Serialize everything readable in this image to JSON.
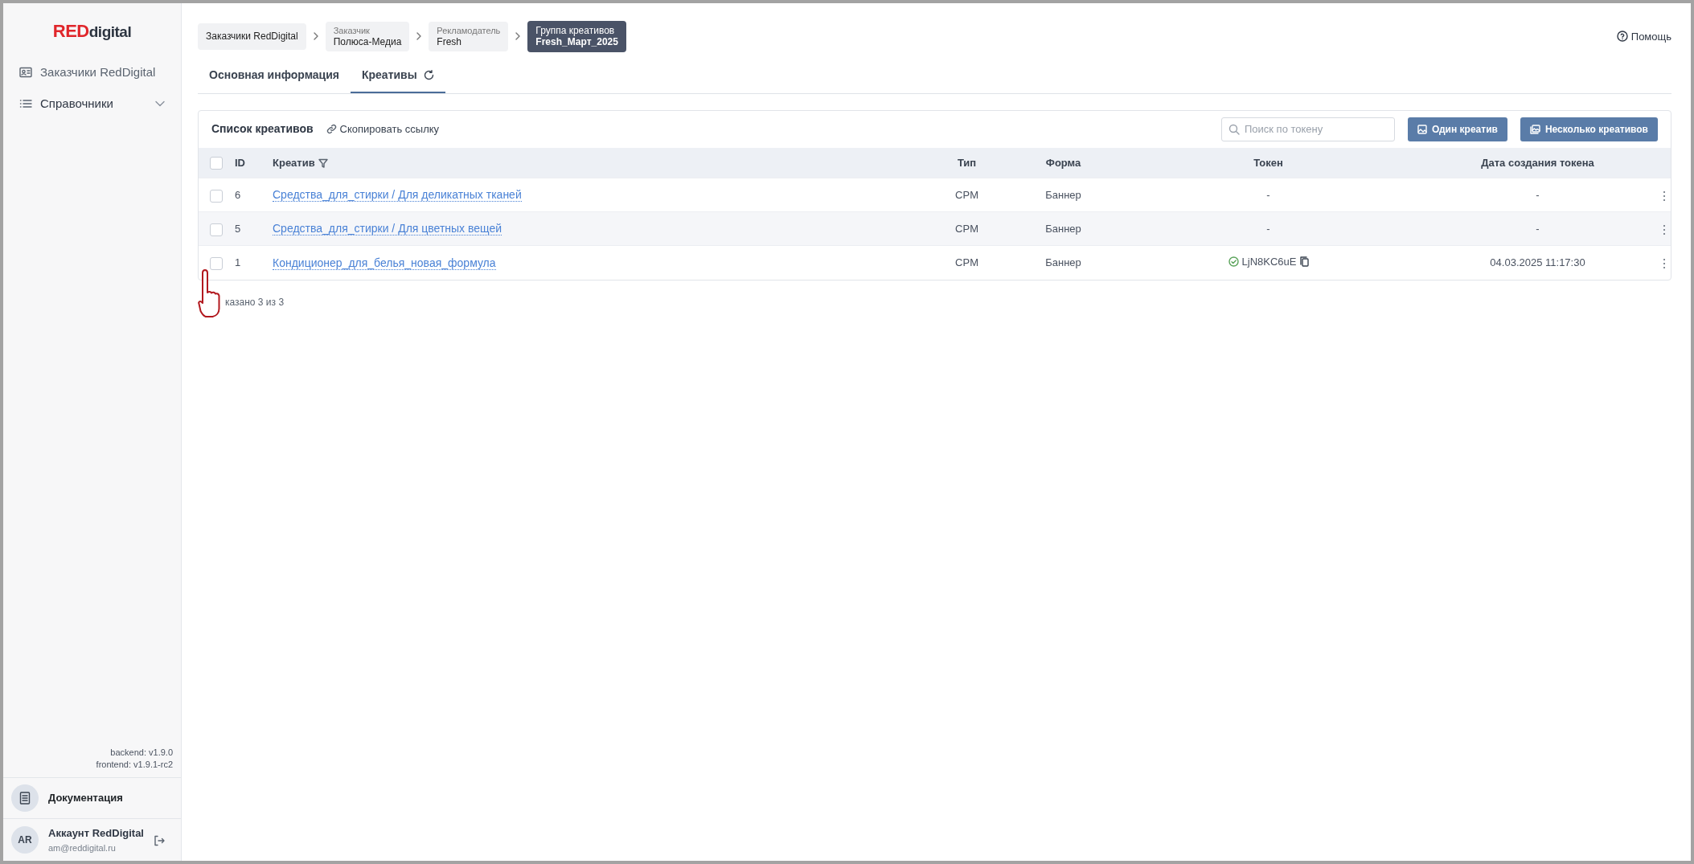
{
  "sidebar": {
    "logo": {
      "strong": "RED",
      "light": "digital"
    },
    "items": [
      {
        "kind": "link",
        "label": "Заказчики RedDigital"
      },
      {
        "kind": "group",
        "label": "Справочники",
        "expanded": false
      }
    ],
    "versions": [
      "backend: v1.9.0",
      "frontend: v1.9.1-rc2"
    ],
    "docs": "Документация",
    "account": {
      "initials": "AR",
      "name": "Аккаунт RedDigital",
      "email": "am@reddigital.ru"
    }
  },
  "breadcrumbs": [
    {
      "label": "Заказчики RedDigital",
      "current": false
    },
    {
      "caption": "Заказчик",
      "label": "Полюса-Медиа",
      "current": false
    },
    {
      "caption": "Рекламодатель",
      "label": "Fresh",
      "current": false
    },
    {
      "caption": "Группа креативов",
      "label": "Fresh_Март_2025",
      "current": true
    }
  ],
  "help": "Помощь",
  "tabs": [
    {
      "label": "Основная информация",
      "selected": false
    },
    {
      "label": "Креативы",
      "selected": true
    }
  ],
  "card": {
    "title": "Список креативов",
    "copy_link": "Скопировать ссылку",
    "search": {
      "placeholder": "Поиск по токену"
    },
    "buttons": [
      "Один креатив",
      "Несколько креативов"
    ]
  },
  "table": {
    "all_checked": false,
    "columns": [
      "ID",
      "Креатив",
      "Тип",
      "Форма",
      "Токен",
      "Дата создания токена"
    ],
    "rows": [
      {
        "checked": false,
        "id": "6",
        "name": "Средства_для_стирки / Для деликатных тканей",
        "type": "CPM",
        "form": "Баннер",
        "token": "-",
        "verified": false,
        "date": "-"
      },
      {
        "checked": false,
        "id": "5",
        "name": "Средства_для_стирки / Для цветных вещей",
        "type": "CPM",
        "form": "Баннер",
        "token": "-",
        "verified": false,
        "date": "-"
      },
      {
        "checked": false,
        "id": "1",
        "name": "Кондиционер_для_белья_новая_формула",
        "type": "CPM",
        "form": "Баннер",
        "token": "LjN8KC6uE",
        "verified": true,
        "date": "04.03.2025 11:17:30"
      }
    ]
  },
  "shown": "казано 3 из 3"
}
